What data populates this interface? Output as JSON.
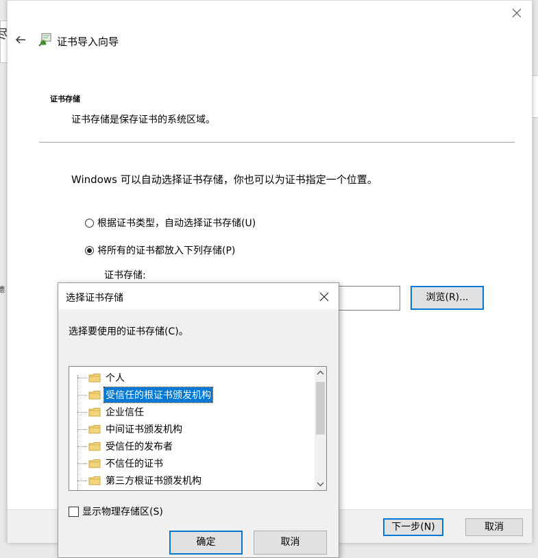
{
  "background": {
    "edge_char": "尽",
    "side_char": "德"
  },
  "wizard": {
    "title": "证书导入向导",
    "section_heading": "证书存储",
    "section_description": "证书存储是保存证书的系统区域。",
    "instruction": "Windows 可以自动选择证书存储，你也可以为证书指定一个位置。",
    "radio_auto": "根据证书类型，自动选择证书存储(U)",
    "radio_manual": "将所有的证书都放入下列存储(P)",
    "selected_option": "radio_manual",
    "store_label": "证书存储:",
    "store_value": "",
    "browse_label": "浏览(R)...",
    "next_label": "下一步(N)",
    "cancel_label": "取消"
  },
  "dialog": {
    "title": "选择证书存储",
    "prompt": "选择要使用的证书存储(C)。",
    "stores": [
      {
        "label": "个人"
      },
      {
        "label": "受信任的根证书颁发机构"
      },
      {
        "label": "企业信任"
      },
      {
        "label": "中间证书颁发机构"
      },
      {
        "label": "受信任的发布者"
      },
      {
        "label": "不信任的证书"
      },
      {
        "label": "第三方根证书颁发机构"
      }
    ],
    "selected_store": "受信任的根证书颁发机构",
    "show_physical_label": "显示物理存储区(S)",
    "show_physical_checked": false,
    "ok_label": "确定",
    "cancel_label": "取消"
  },
  "colors": {
    "accent": "#0078d7",
    "folder": "#f4d47a"
  }
}
